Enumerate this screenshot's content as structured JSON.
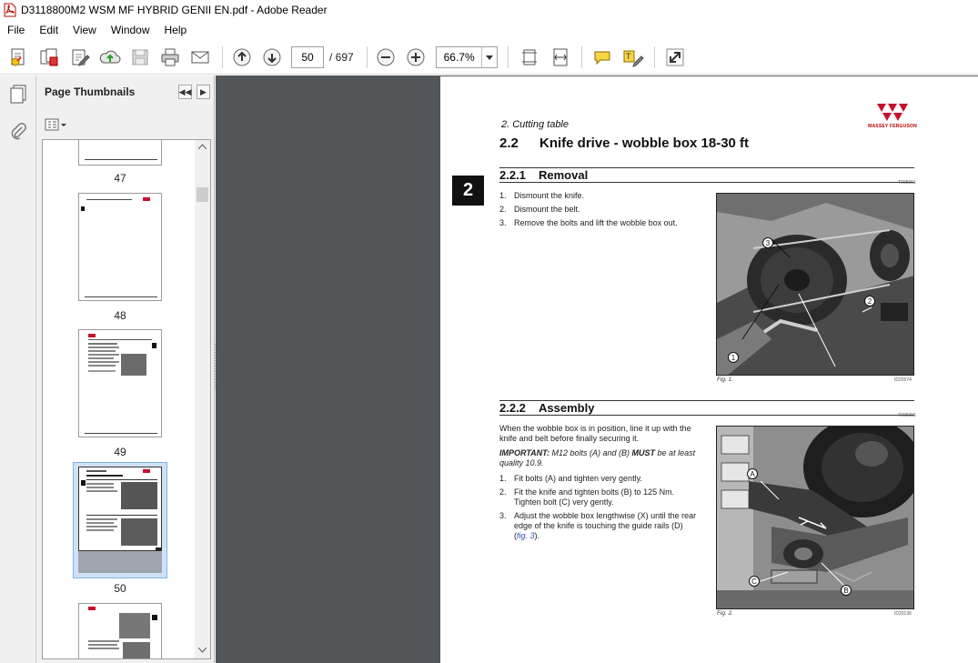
{
  "window": {
    "title": "D3118800M2 WSM MF HYBRID GENII EN.pdf - Adobe Reader"
  },
  "menu": [
    "File",
    "Edit",
    "View",
    "Window",
    "Help"
  ],
  "toolbar": {
    "icons": [
      "create-pdf-icon",
      "combine-icon",
      "edit-icon",
      "upload-icon",
      "save-icon",
      "print-icon",
      "email-icon",
      "previous-page-icon",
      "next-page-icon",
      "zoom-out-icon",
      "zoom-in-icon",
      "fit-page-icon",
      "fit-width-icon",
      "comment-icon",
      "highlight-icon",
      "expand-icon"
    ],
    "page_current": "50",
    "page_total": "/ 697",
    "zoom": "66.7%"
  },
  "thumbnails": {
    "title": "Page Thumbnails",
    "pages": [
      "47",
      "48",
      "49",
      "50"
    ],
    "selected": "50"
  },
  "pdf": {
    "chapter": "2. Cutting table",
    "section_badge": "2",
    "logo": "MASSEY FERGUSON",
    "h1_num": "2.2",
    "h1_text": "Knife drive - wobble box 18-30 ft",
    "s1_num": "2.2.1",
    "s1_text": "Removal",
    "s1_code": "T005961",
    "removal_steps": [
      "Dismount the knife.",
      "Dismount the belt.",
      "Remove the bolts and lift the wobble box out."
    ],
    "fig1_caption": "Fig. 1.",
    "fig1_code": "ID20574",
    "fig1_callouts": [
      "3",
      "2",
      "1"
    ],
    "s2_num": "2.2.2",
    "s2_text": "Assembly",
    "s2_code": "T005965",
    "assembly_intro": "When the wobble box is in position, line it up with the knife and belt before finally securing it.",
    "important_label": "IMPORTANT:",
    "important_text": " M12 bolts (A) and (B) ",
    "important_must": "MUST",
    "important_tail": " be at least quality 10.9.",
    "assembly_steps": [
      "Fit bolts (A) and tighten very gently.",
      "Fit the knife and tighten bolts (B) to 125 Nm. Tighten bolt (C) very gently.",
      "Adjust the wobble box lengthwise (X) until the rear edge of the knife is touching the guide rails (D) ("
    ],
    "step3_link": "fig. 3",
    "step3_end": ").",
    "fig2_caption": "Fig. 2.",
    "fig2_code": "ID20136",
    "fig2_callouts": [
      "A",
      "C",
      "B"
    ]
  },
  "colors": {
    "workspace": "#525659",
    "brand_red": "#c8102e",
    "selection": "#cfe2f5"
  }
}
